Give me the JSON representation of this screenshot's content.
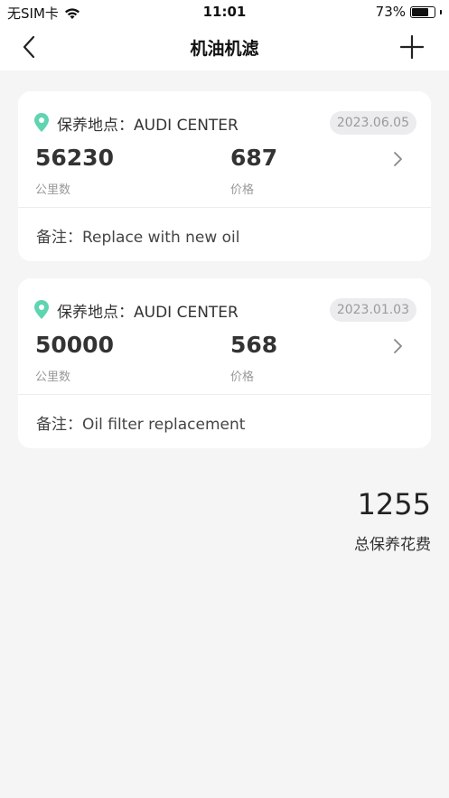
{
  "status_bar": {
    "carrier": "无SIM卡",
    "time": "11:01",
    "battery_percent": "73%",
    "battery_level": 0.73
  },
  "nav": {
    "title": "机油机滤"
  },
  "records": [
    {
      "location_label": "保养地点：",
      "location": "AUDI CENTER",
      "date": "2023.06.05",
      "mileage": "56230",
      "mileage_label": "公里数",
      "price": "687",
      "price_label": "价格",
      "note_label": "备注：",
      "note": "Replace with new oil"
    },
    {
      "location_label": "保养地点：",
      "location": "AUDI CENTER",
      "date": "2023.01.03",
      "mileage": "50000",
      "mileage_label": "公里数",
      "price": "568",
      "price_label": "价格",
      "note_label": "备注：",
      "note": "Oil filter replacement"
    }
  ],
  "total": {
    "value": "1255",
    "label": "总保养花费"
  },
  "colors": {
    "accent": "#5fd4b0",
    "background": "#f5f5f5",
    "card": "#ffffff"
  }
}
